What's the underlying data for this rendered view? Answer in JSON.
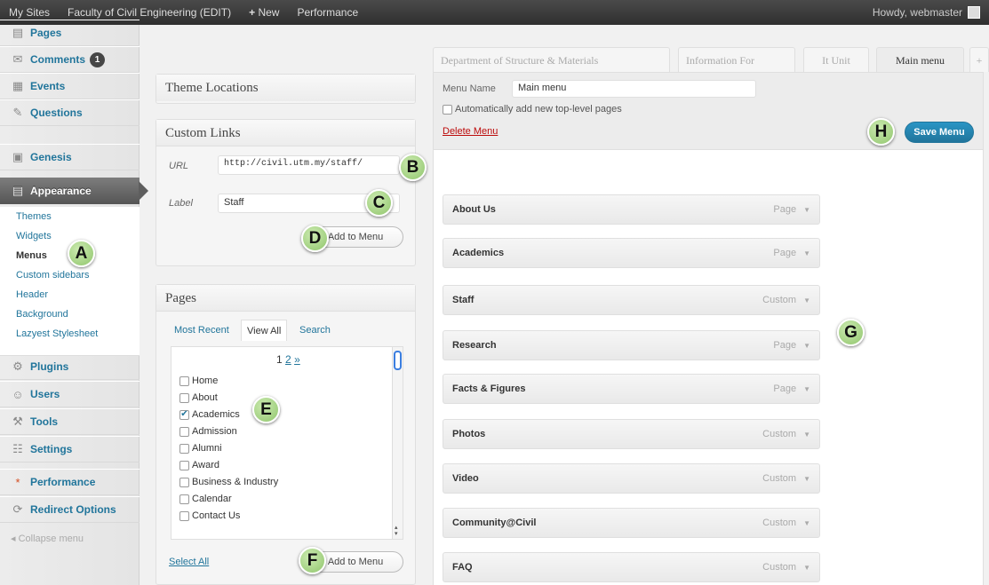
{
  "adminbar": {
    "my_sites": "My Sites",
    "site_name": "Faculty of Civil Engineering (EDIT)",
    "new_label": "New",
    "performance": "Performance",
    "howdy": "Howdy, webmaster"
  },
  "sidebar": {
    "items": [
      {
        "label": "Pages",
        "icon": "pages-icon"
      },
      {
        "label": "Comments",
        "icon": "comments-icon",
        "badge": "1"
      },
      {
        "label": "Events",
        "icon": "events-icon"
      },
      {
        "label": "Questions",
        "icon": "questions-icon"
      },
      {
        "label": "Genesis",
        "icon": "genesis-icon"
      },
      {
        "label": "Appearance",
        "icon": "appearance-icon"
      },
      {
        "label": "Plugins",
        "icon": "plugins-icon"
      },
      {
        "label": "Users",
        "icon": "users-icon"
      },
      {
        "label": "Tools",
        "icon": "tools-icon"
      },
      {
        "label": "Settings",
        "icon": "settings-icon"
      },
      {
        "label": "Performance",
        "icon": "performance-icon"
      },
      {
        "label": "Redirect Options",
        "icon": "redirect-icon"
      }
    ],
    "submenu": [
      "Themes",
      "Widgets",
      "Menus",
      "Custom sidebars",
      "Header",
      "Background",
      "Lazyest Stylesheet"
    ],
    "collapse": "Collapse menu"
  },
  "theme_locations": {
    "title": "Theme Locations"
  },
  "custom_links": {
    "title": "Custom Links",
    "url_label": "URL",
    "url_value": "http://civil.utm.my/staff/",
    "label_label": "Label",
    "label_value": "Staff",
    "add_button": "Add to Menu"
  },
  "pages_box": {
    "title": "Pages",
    "tabs": [
      "Most Recent",
      "View All",
      "Search"
    ],
    "pagination": [
      "1",
      "2",
      "»"
    ],
    "items": [
      {
        "label": "Home",
        "checked": false
      },
      {
        "label": "About",
        "checked": false
      },
      {
        "label": "Academics",
        "checked": true
      },
      {
        "label": "Admission",
        "checked": false
      },
      {
        "label": "Alumni",
        "checked": false
      },
      {
        "label": "Award",
        "checked": false
      },
      {
        "label": "Business & Industry",
        "checked": false
      },
      {
        "label": "Calendar",
        "checked": false
      },
      {
        "label": "Contact Us",
        "checked": false
      }
    ],
    "select_all": "Select All",
    "add_button": "Add to Menu"
  },
  "menu_tabs": [
    "Department of Structure & Materials",
    "Information For",
    "It Unit",
    "Main menu",
    "+"
  ],
  "menu_editor": {
    "name_label": "Menu Name",
    "name_value": "Main menu",
    "auto_add": "Automatically add new top-level pages",
    "delete": "Delete Menu",
    "save": "Save Menu",
    "items": [
      {
        "title": "About Us",
        "type": "Page"
      },
      {
        "title": "Academics",
        "type": "Page"
      },
      {
        "title": "Staff",
        "type": "Custom"
      },
      {
        "title": "Research",
        "type": "Page"
      },
      {
        "title": "Facts & Figures",
        "type": "Page"
      },
      {
        "title": "Photos",
        "type": "Custom"
      },
      {
        "title": "Video",
        "type": "Custom"
      },
      {
        "title": "Community@Civil",
        "type": "Custom"
      },
      {
        "title": "FAQ",
        "type": "Custom"
      }
    ]
  },
  "markers": [
    "A",
    "B",
    "C",
    "D",
    "E",
    "F",
    "G",
    "H"
  ],
  "colors": {
    "link": "#21759b",
    "marker": "#8fc56b",
    "adminbar": "#464646",
    "delete": "#bc0b0b"
  }
}
